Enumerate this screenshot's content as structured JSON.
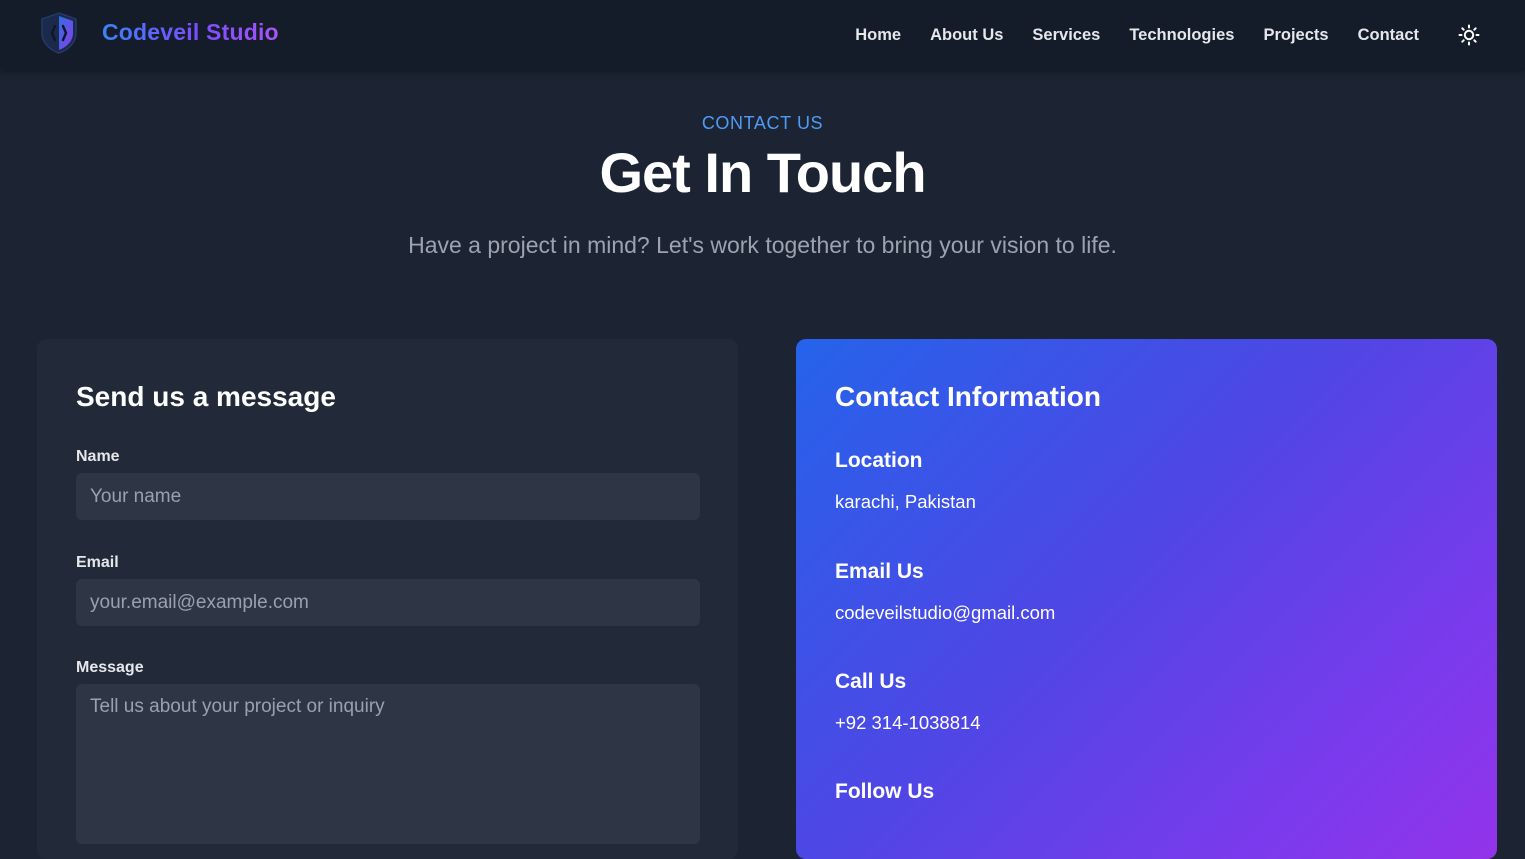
{
  "brand": {
    "name": "Codeveil Studio"
  },
  "nav": {
    "items": [
      "Home",
      "About Us",
      "Services",
      "Technologies",
      "Projects",
      "Contact"
    ],
    "theme_icon": "sun-icon"
  },
  "hero": {
    "eyebrow": "CONTACT US",
    "title": "Get In Touch",
    "subtitle": "Have a project in mind? Let's work together to bring your vision to life."
  },
  "form": {
    "title": "Send us a message",
    "name_label": "Name",
    "name_placeholder": "Your name",
    "email_label": "Email",
    "email_placeholder": "your.email@example.com",
    "message_label": "Message",
    "message_placeholder": "Tell us about your project or inquiry"
  },
  "contact_info": {
    "title": "Contact Information",
    "location_heading": "Location",
    "location_value": "karachi, Pakistan",
    "email_heading": "Email Us",
    "email_value": "codeveilstudio@gmail.com",
    "phone_heading": "Call Us",
    "phone_value": "+92 314-1038814",
    "social_heading": "Follow Us"
  },
  "colors": {
    "accent_blue": "#4f9cf5",
    "brand_gradient_start": "#3b82f6",
    "brand_gradient_end": "#a855f7",
    "info_gradient_start": "#2563eb",
    "info_gradient_end": "#9333ea"
  }
}
